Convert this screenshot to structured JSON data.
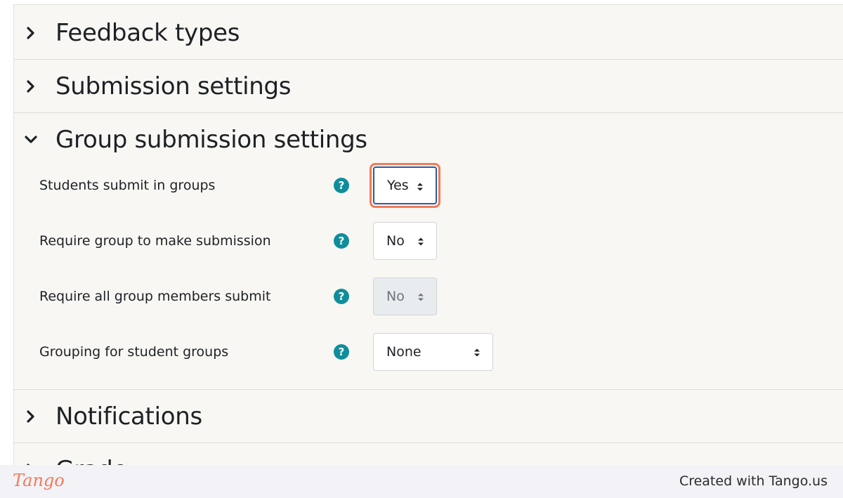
{
  "sections": [
    {
      "title": "Feedback types",
      "expanded": false
    },
    {
      "title": "Submission settings",
      "expanded": false
    },
    {
      "title": "Group submission settings",
      "expanded": true
    },
    {
      "title": "Notifications",
      "expanded": false
    },
    {
      "title": "Grade",
      "expanded": false
    }
  ],
  "group_settings": [
    {
      "label": "Students submit in groups",
      "value": "Yes",
      "disabled": false,
      "highlighted": true
    },
    {
      "label": "Require group to make submission",
      "value": "No",
      "disabled": false,
      "highlighted": false
    },
    {
      "label": "Require all group members submit",
      "value": "No",
      "disabled": true,
      "highlighted": false
    },
    {
      "label": "Grouping for student groups",
      "value": "None",
      "disabled": false,
      "highlighted": false
    }
  ],
  "help_glyph": "?",
  "icons": {
    "collapsed": "chevron-right-icon",
    "expanded": "chevron-down-icon",
    "help": "question-circle-icon",
    "select": "sort-arrows-icon"
  },
  "colors": {
    "accent_highlight": "#ef7c5a",
    "help_icon": "#0f8d9b",
    "focus_border": "#2f5a9c"
  },
  "footer": {
    "logo": "Tango",
    "created_with": "Created with Tango.us"
  }
}
